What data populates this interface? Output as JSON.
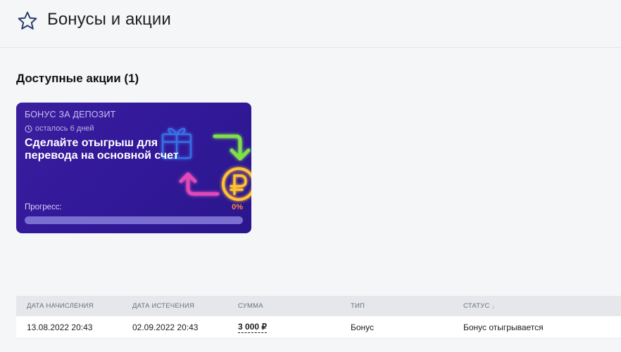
{
  "header": {
    "title": "Бонусы и акции",
    "icon": "star-icon"
  },
  "section": {
    "title": "Доступные акции (1)"
  },
  "promo": {
    "type_label": "БОНУС ЗА ДЕПОЗИТ",
    "time_left": "осталось 6 дней",
    "heading": "Сделайте отыгрыш для перевода на основной счет",
    "progress_label": "Прогресс:",
    "progress_text": "0%",
    "progress_fraction": 0,
    "colors": {
      "background": "#32199a",
      "accent": "#ff8a3d",
      "track": "#7a6fd0"
    }
  },
  "table": {
    "columns": [
      "ДАТА НАЧИСЛЕНИЯ",
      "ДАТА ИСТЕЧЕНИЯ",
      "СУММА",
      "ТИП",
      "СТАТУС"
    ],
    "sort_indicator": "↓",
    "rows": [
      {
        "accrual_date": "13.08.2022 20:43",
        "expiry_date": "02.09.2022 20:43",
        "amount": "3 000 ₽",
        "type": "Бонус",
        "status": "Бонус отыгрывается"
      }
    ]
  }
}
